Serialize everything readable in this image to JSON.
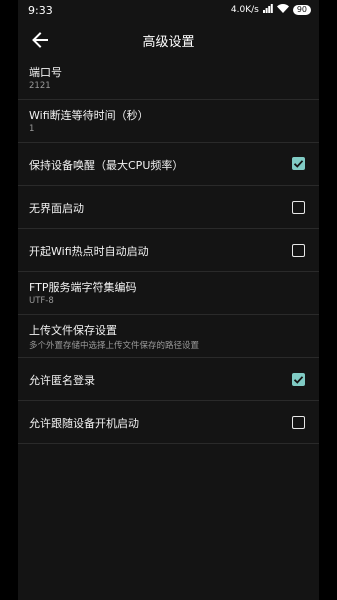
{
  "status": {
    "time": "9:33",
    "speed": "4.0K/s",
    "battery": "90"
  },
  "header": {
    "title": "高级设置"
  },
  "settings": {
    "port": {
      "title": "端口号",
      "value": "2121"
    },
    "wifi_wait": {
      "title": "Wifi断连等待时间（秒）",
      "value": "1"
    },
    "keep_awake": {
      "title": "保持设备唤醒（最大CPU频率）",
      "checked": true
    },
    "headless": {
      "title": "无界面启动",
      "checked": false
    },
    "hotspot": {
      "title": "开起Wifi热点时自动启动",
      "checked": false
    },
    "charset": {
      "title": "FTP服务端字符集编码",
      "value": "UTF-8"
    },
    "upload": {
      "title": "上传文件保存设置",
      "value": "多个外置存储中选择上传文件保存的路径设置"
    },
    "anonymous": {
      "title": "允许匿名登录",
      "checked": true
    },
    "boot": {
      "title": "允许跟随设备开机启动",
      "checked": false
    }
  },
  "colors": {
    "accent": "#80cbc4",
    "background": "#141414"
  }
}
